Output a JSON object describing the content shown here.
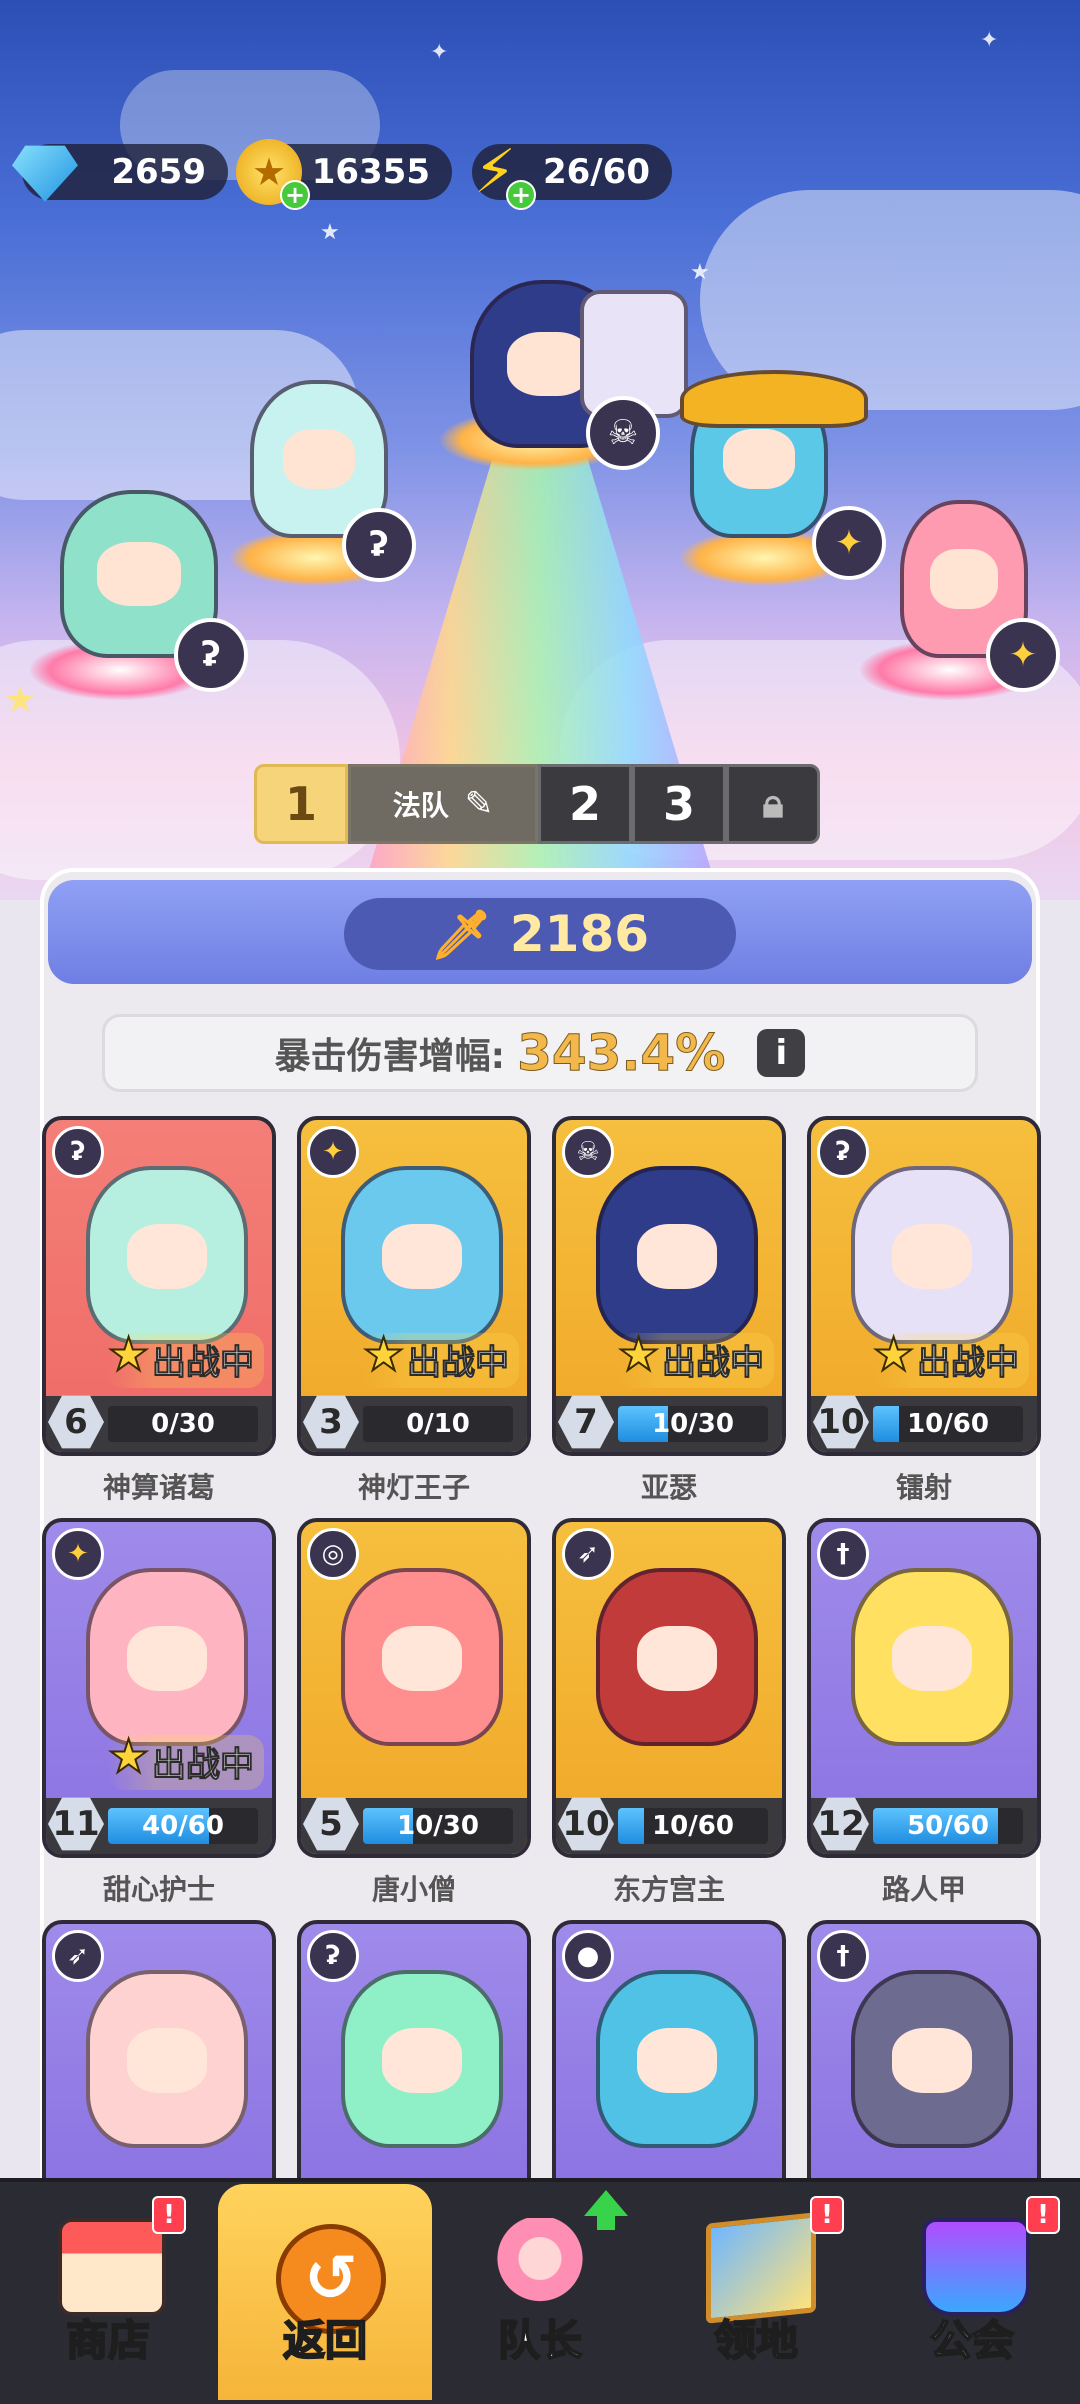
{
  "resources": {
    "gems": "2659",
    "coins": "16355",
    "energy": "26/60",
    "icons": {
      "gems": "gem-icon",
      "coins": "coin-icon",
      "energy": "lightning-icon"
    }
  },
  "team_tabs": {
    "active_number": "1",
    "team_name": "法队",
    "tab2": "2",
    "tab3": "3",
    "locked_icon": "lock-icon"
  },
  "power": {
    "value": "2186",
    "icon": "sword-icon"
  },
  "crit_bonus": {
    "label": "暴击伤害增幅:",
    "value": "343.4%",
    "info_icon": "info-icon"
  },
  "deployed_label": "出战中",
  "heroes": [
    {
      "name": "神算诸葛",
      "level": "6",
      "progress": "0/30",
      "progress_frac": 0.0,
      "rarity": "red",
      "class_icon": "ʡ",
      "deployed": true
    },
    {
      "name": "神灯王子",
      "level": "3",
      "progress": "0/10",
      "progress_frac": 0.0,
      "rarity": "gold",
      "class_icon": "✦",
      "deployed": true
    },
    {
      "name": "亚瑟",
      "level": "7",
      "progress": "10/30",
      "progress_frac": 0.33,
      "rarity": "gold",
      "class_icon": "☠",
      "deployed": true
    },
    {
      "name": "镭射",
      "level": "10",
      "progress": "10/60",
      "progress_frac": 0.17,
      "rarity": "gold",
      "class_icon": "ʡ",
      "deployed": true
    },
    {
      "name": "甜心护士",
      "level": "11",
      "progress": "40/60",
      "progress_frac": 0.67,
      "rarity": "purple",
      "class_icon": "✦",
      "deployed": true
    },
    {
      "name": "唐小僧",
      "level": "5",
      "progress": "10/30",
      "progress_frac": 0.33,
      "rarity": "gold",
      "class_icon": "◎",
      "deployed": false
    },
    {
      "name": "东方宫主",
      "level": "10",
      "progress": "10/60",
      "progress_frac": 0.17,
      "rarity": "gold",
      "class_icon": "➶",
      "deployed": false
    },
    {
      "name": "路人甲",
      "level": "12",
      "progress": "50/60",
      "progress_frac": 0.83,
      "rarity": "purple",
      "class_icon": "†",
      "deployed": false
    },
    {
      "name": "",
      "level": "",
      "progress": "",
      "progress_frac": 0,
      "rarity": "purple",
      "class_icon": "➶",
      "deployed": false
    },
    {
      "name": "",
      "level": "",
      "progress": "",
      "progress_frac": 0,
      "rarity": "purple",
      "class_icon": "ʡ",
      "deployed": false
    },
    {
      "name": "",
      "level": "",
      "progress": "",
      "progress_frac": 0,
      "rarity": "purple",
      "class_icon": "●",
      "deployed": false
    },
    {
      "name": "",
      "level": "",
      "progress": "",
      "progress_frac": 0,
      "rarity": "purple",
      "class_icon": "†",
      "deployed": false
    }
  ],
  "nav": [
    {
      "label": "商店",
      "icon": "shop-icon",
      "alert": "!"
    },
    {
      "label": "返回",
      "icon": "back-arrow-icon",
      "alert": ""
    },
    {
      "label": "队长",
      "icon": "captain-icon",
      "alert": ""
    },
    {
      "label": "领地",
      "icon": "territory-icon",
      "alert": "!"
    },
    {
      "label": "公会",
      "icon": "guild-icon",
      "alert": "!"
    }
  ]
}
